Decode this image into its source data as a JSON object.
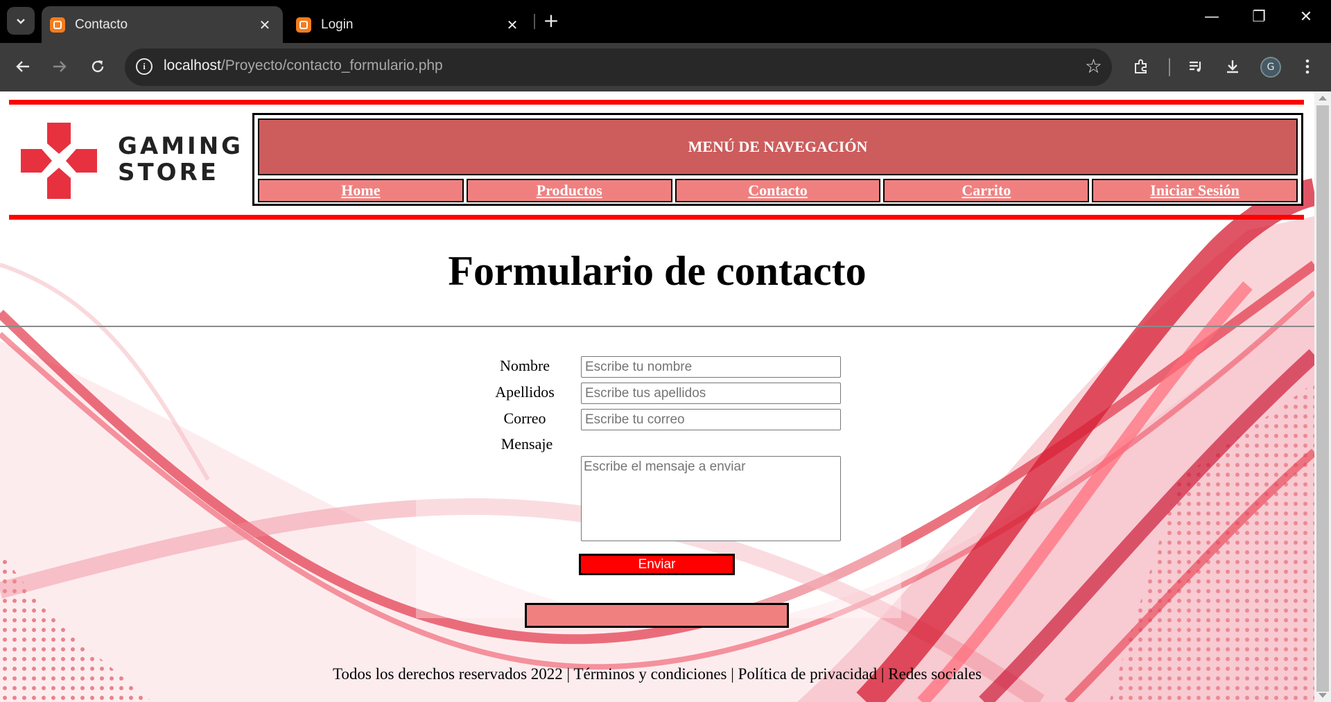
{
  "browser": {
    "tabs": [
      {
        "title": "Contacto",
        "active": true
      },
      {
        "title": "Login",
        "active": false
      }
    ],
    "url_host": "localhost",
    "url_path": "/Proyecto/contacto_formulario.php",
    "profile_initial": "G",
    "icons": [
      "tab-search-icon",
      "back-icon",
      "forward-icon",
      "reload-icon",
      "site-info-icon",
      "bookmark-star-icon",
      "extensions-icon",
      "media-control-icon",
      "download-icon",
      "menu-icon"
    ]
  },
  "header": {
    "logo_line1": "GAMING",
    "logo_line2": "STORE",
    "nav_title": "MENÚ DE NAVEGACIÓN",
    "nav_items": [
      {
        "label": "Home"
      },
      {
        "label": "Productos"
      },
      {
        "label": "Contacto"
      },
      {
        "label": "Carrito"
      },
      {
        "label": "Iniciar Sesión"
      }
    ]
  },
  "main": {
    "title": "Formulario de contacto",
    "form": {
      "name_label": "Nombre",
      "name_placeholder": "Escribe tu nombre",
      "surname_label": "Apellidos",
      "surname_placeholder": "Escribe tus apellidos",
      "email_label": "Correo",
      "email_placeholder": "Escribe tu correo",
      "message_label": "Mensaje",
      "message_placeholder": "Escribe el mensaje a enviar",
      "submit_label": "Enviar"
    }
  },
  "footer": {
    "text": "Todos los derechos reservados 2022 | Términos y condiciones | Política de privacidad | Redes sociales"
  },
  "colors": {
    "accent_red": "#ff0000",
    "nav_header": "#cd5c5c",
    "nav_cell": "#f08080",
    "logo_red": "#e8313f"
  }
}
